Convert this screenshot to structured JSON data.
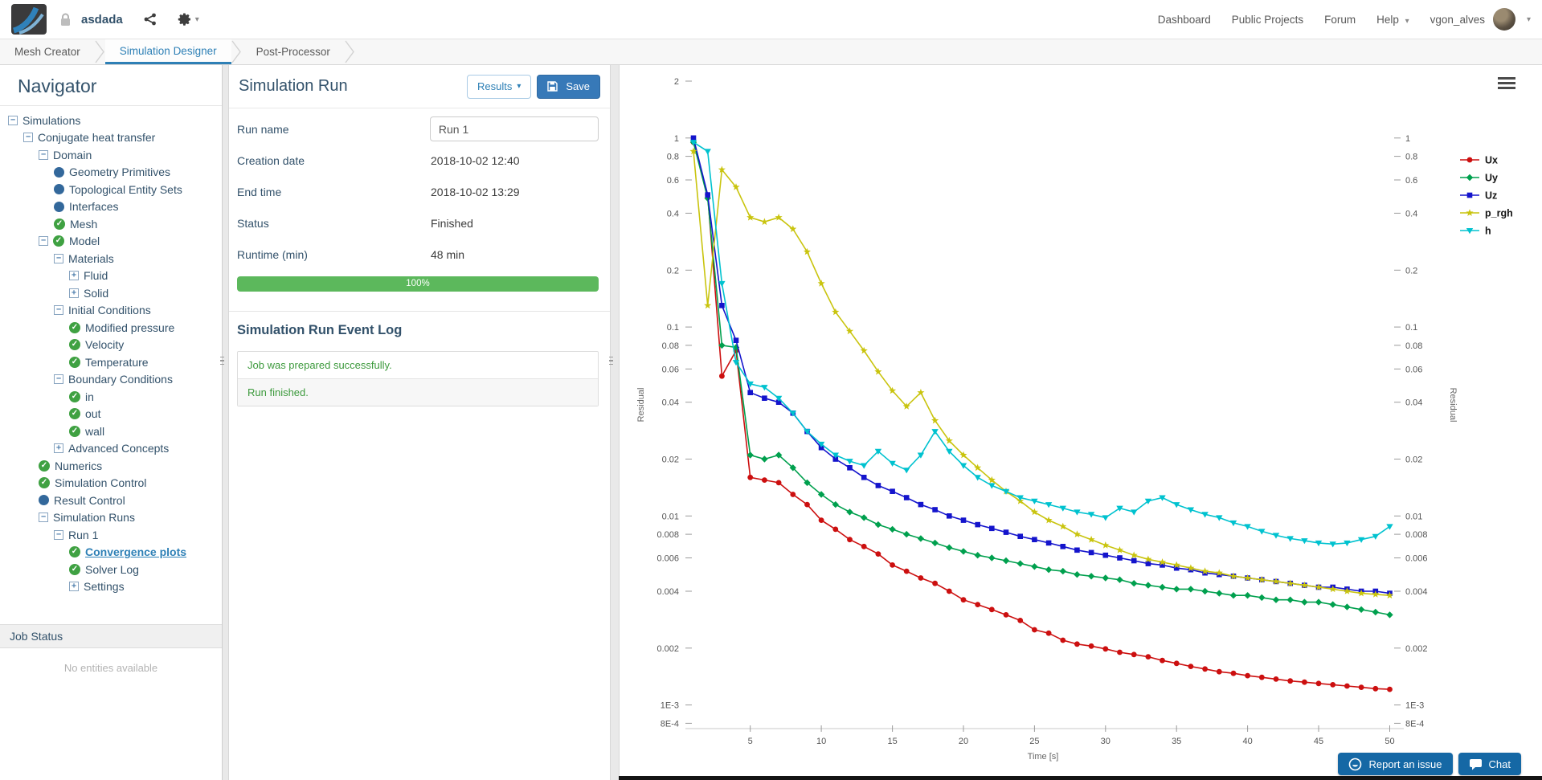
{
  "navbar": {
    "project_name": "asdada",
    "links": [
      "Dashboard",
      "Public Projects",
      "Forum"
    ],
    "help_label": "Help",
    "username": "vgon_alves"
  },
  "tabs": [
    {
      "label": "Mesh Creator",
      "active": false
    },
    {
      "label": "Simulation Designer",
      "active": true
    },
    {
      "label": "Post-Processor",
      "active": false
    }
  ],
  "navigator": {
    "title": "Navigator",
    "tree": [
      {
        "label": "Simulations",
        "level": 0,
        "box": "minus",
        "mark": null
      },
      {
        "label": "Conjugate heat transfer",
        "level": 1,
        "box": "minus",
        "mark": null
      },
      {
        "label": "Domain",
        "level": 2,
        "box": "minus",
        "mark": null
      },
      {
        "label": "Geometry Primitives",
        "level": 3,
        "box": null,
        "mark": "dot"
      },
      {
        "label": "Topological Entity Sets",
        "level": 3,
        "box": null,
        "mark": "dot"
      },
      {
        "label": "Interfaces",
        "level": 3,
        "box": null,
        "mark": "dot"
      },
      {
        "label": "Mesh",
        "level": 3,
        "box": null,
        "mark": "check"
      },
      {
        "label": "Model",
        "level": 2,
        "box": "minus",
        "mark": "check"
      },
      {
        "label": "Materials",
        "level": 3,
        "box": "minus",
        "mark": null
      },
      {
        "label": "Fluid",
        "level": 4,
        "box": "plus",
        "mark": null
      },
      {
        "label": "Solid",
        "level": 4,
        "box": "plus",
        "mark": null
      },
      {
        "label": "Initial Conditions",
        "level": 3,
        "box": "minus",
        "mark": null
      },
      {
        "label": "Modified pressure",
        "level": 4,
        "box": null,
        "mark": "check"
      },
      {
        "label": "Velocity",
        "level": 4,
        "box": null,
        "mark": "check"
      },
      {
        "label": "Temperature",
        "level": 4,
        "box": null,
        "mark": "check"
      },
      {
        "label": "Boundary Conditions",
        "level": 3,
        "box": "minus",
        "mark": null
      },
      {
        "label": "in",
        "level": 4,
        "box": null,
        "mark": "check"
      },
      {
        "label": "out",
        "level": 4,
        "box": null,
        "mark": "check"
      },
      {
        "label": "wall",
        "level": 4,
        "box": null,
        "mark": "check"
      },
      {
        "label": "Advanced Concepts",
        "level": 3,
        "box": "plus",
        "mark": null
      },
      {
        "label": "Numerics",
        "level": 2,
        "box": null,
        "mark": "check"
      },
      {
        "label": "Simulation Control",
        "level": 2,
        "box": null,
        "mark": "check"
      },
      {
        "label": "Result Control",
        "level": 2,
        "box": null,
        "mark": "dot"
      },
      {
        "label": "Simulation Runs",
        "level": 2,
        "box": "minus",
        "mark": null
      },
      {
        "label": "Run 1",
        "level": 3,
        "box": "minus",
        "mark": null
      },
      {
        "label": "Convergence plots",
        "level": 4,
        "box": null,
        "mark": "check",
        "selected": true
      },
      {
        "label": "Solver Log",
        "level": 4,
        "box": null,
        "mark": "check"
      },
      {
        "label": "Settings",
        "level": 4,
        "box": "plus",
        "mark": null
      }
    ],
    "job_status": {
      "title": "Job Status",
      "empty_text": "No entities available"
    }
  },
  "run_panel": {
    "title": "Simulation Run",
    "results_button": "Results",
    "save_button": "Save",
    "fields": [
      {
        "label": "Run name",
        "value": "Run 1",
        "type": "input"
      },
      {
        "label": "Creation date",
        "value": "2018-10-02 12:40"
      },
      {
        "label": "End time",
        "value": "2018-10-02 13:29"
      },
      {
        "label": "Status",
        "value": "Finished"
      },
      {
        "label": "Runtime (min)",
        "value": "48 min"
      }
    ],
    "progress": {
      "label": "100%",
      "percent": 100,
      "color": "#5cb85c"
    },
    "event_log": {
      "title": "Simulation Run Event Log",
      "events": [
        "Job was prepared successfully.",
        "Run finished."
      ]
    }
  },
  "footer_buttons": [
    {
      "label": "Report an issue",
      "icon": "smiley-icon"
    },
    {
      "label": "Chat",
      "icon": "chat-icon"
    }
  ],
  "chart_data": {
    "type": "line",
    "xlabel": "Time [s]",
    "ylabel_left": "Residual",
    "ylabel_right": "Residual",
    "y_scale": "log",
    "grid": false,
    "legend_position": "right",
    "xlim": [
      1,
      50.2
    ],
    "ylim": [
      0.00075,
      2.0
    ],
    "x_ticks": [
      5,
      10,
      15,
      20,
      25,
      30,
      35,
      40,
      45,
      50
    ],
    "y_ticks_left": [
      {
        "v": 2,
        "label": "2"
      },
      {
        "v": 1,
        "label": "1"
      },
      {
        "v": 0.8,
        "label": "0.8"
      },
      {
        "v": 0.6,
        "label": "0.6"
      },
      {
        "v": 0.4,
        "label": "0.4"
      },
      {
        "v": 0.2,
        "label": "0.2"
      },
      {
        "v": 0.1,
        "label": "0.1"
      },
      {
        "v": 0.08,
        "label": "0.08"
      },
      {
        "v": 0.06,
        "label": "0.06"
      },
      {
        "v": 0.04,
        "label": "0.04"
      },
      {
        "v": 0.02,
        "label": "0.02"
      },
      {
        "v": 0.01,
        "label": "0.01"
      },
      {
        "v": 0.008,
        "label": "0.008"
      },
      {
        "v": 0.006,
        "label": "0.006"
      },
      {
        "v": 0.004,
        "label": "0.004"
      },
      {
        "v": 0.002,
        "label": "0.002"
      },
      {
        "v": 0.001,
        "label": "1E-3"
      },
      {
        "v": 0.0008,
        "label": "8E-4"
      }
    ],
    "y_ticks_right": [
      {
        "v": 1,
        "label": "1"
      },
      {
        "v": 0.8,
        "label": "0.8"
      },
      {
        "v": 0.6,
        "label": "0.6"
      },
      {
        "v": 0.4,
        "label": "0.4"
      },
      {
        "v": 0.2,
        "label": "0.2"
      },
      {
        "v": 0.1,
        "label": "0.1"
      },
      {
        "v": 0.08,
        "label": "0.08"
      },
      {
        "v": 0.06,
        "label": "0.06"
      },
      {
        "v": 0.04,
        "label": "0.04"
      },
      {
        "v": 0.02,
        "label": "0.02"
      },
      {
        "v": 0.01,
        "label": "0.01"
      },
      {
        "v": 0.008,
        "label": "0.008"
      },
      {
        "v": 0.006,
        "label": "0.006"
      },
      {
        "v": 0.004,
        "label": "0.004"
      },
      {
        "v": 0.002,
        "label": "0.002"
      },
      {
        "v": 0.001,
        "label": "1E-3"
      },
      {
        "v": 0.0008,
        "label": "8E-4"
      }
    ],
    "x": [
      1,
      2,
      3,
      4,
      5,
      6,
      7,
      8,
      9,
      10,
      11,
      12,
      13,
      14,
      15,
      16,
      17,
      18,
      19,
      20,
      21,
      22,
      23,
      24,
      25,
      26,
      27,
      28,
      29,
      30,
      31,
      32,
      33,
      34,
      35,
      36,
      37,
      38,
      39,
      40,
      41,
      42,
      43,
      44,
      45,
      46,
      47,
      48,
      49,
      50
    ],
    "series": [
      {
        "name": "Ux",
        "color": "#cc0f0f",
        "marker": "circle",
        "y": [
          0.95,
          0.5,
          0.055,
          0.075,
          0.016,
          0.0155,
          0.015,
          0.013,
          0.0115,
          0.0095,
          0.0085,
          0.0075,
          0.0069,
          0.0063,
          0.0055,
          0.0051,
          0.0047,
          0.0044,
          0.004,
          0.0036,
          0.0034,
          0.0032,
          0.003,
          0.0028,
          0.0025,
          0.0024,
          0.0022,
          0.0021,
          0.00205,
          0.00198,
          0.0019,
          0.00185,
          0.0018,
          0.00172,
          0.00166,
          0.0016,
          0.00155,
          0.0015,
          0.00147,
          0.00143,
          0.0014,
          0.00137,
          0.00134,
          0.00132,
          0.0013,
          0.00128,
          0.00126,
          0.00124,
          0.00122,
          0.00121
        ]
      },
      {
        "name": "Uy",
        "color": "#00a04e",
        "marker": "diamond",
        "y": [
          0.95,
          0.48,
          0.08,
          0.078,
          0.021,
          0.02,
          0.021,
          0.018,
          0.015,
          0.013,
          0.0115,
          0.0105,
          0.0098,
          0.009,
          0.0085,
          0.008,
          0.0076,
          0.0072,
          0.0068,
          0.0065,
          0.0062,
          0.006,
          0.0058,
          0.0056,
          0.0054,
          0.0052,
          0.0051,
          0.0049,
          0.0048,
          0.0047,
          0.0046,
          0.0044,
          0.0043,
          0.0042,
          0.0041,
          0.0041,
          0.004,
          0.0039,
          0.0038,
          0.0038,
          0.0037,
          0.0036,
          0.0036,
          0.0035,
          0.0035,
          0.0034,
          0.0033,
          0.0032,
          0.0031,
          0.003
        ]
      },
      {
        "name": "Uz",
        "color": "#1414cc",
        "marker": "square",
        "y": [
          1.0,
          0.5,
          0.13,
          0.085,
          0.045,
          0.042,
          0.04,
          0.035,
          0.028,
          0.023,
          0.02,
          0.018,
          0.016,
          0.0145,
          0.0135,
          0.0125,
          0.0115,
          0.0108,
          0.01,
          0.0095,
          0.009,
          0.0086,
          0.0082,
          0.0078,
          0.0075,
          0.0072,
          0.0069,
          0.0066,
          0.0064,
          0.0062,
          0.006,
          0.0058,
          0.0056,
          0.0055,
          0.0053,
          0.0052,
          0.005,
          0.0049,
          0.0048,
          0.0047,
          0.0046,
          0.0045,
          0.0044,
          0.0043,
          0.0042,
          0.0042,
          0.0041,
          0.004,
          0.004,
          0.0039
        ]
      },
      {
        "name": "p_rgh",
        "color": "#c9c40e",
        "marker": "star",
        "y": [
          0.85,
          0.13,
          0.68,
          0.55,
          0.38,
          0.36,
          0.38,
          0.33,
          0.25,
          0.17,
          0.12,
          0.095,
          0.075,
          0.058,
          0.046,
          0.038,
          0.045,
          0.032,
          0.025,
          0.021,
          0.018,
          0.0155,
          0.0135,
          0.012,
          0.0105,
          0.0095,
          0.0088,
          0.008,
          0.0075,
          0.007,
          0.0066,
          0.0062,
          0.0059,
          0.0057,
          0.0055,
          0.0053,
          0.0051,
          0.005,
          0.0048,
          0.0047,
          0.0046,
          0.0045,
          0.0044,
          0.0043,
          0.0042,
          0.0041,
          0.004,
          0.0039,
          0.00385,
          0.0038
        ]
      },
      {
        "name": "h",
        "color": "#00c2cf",
        "marker": "triangle-down",
        "y": [
          0.95,
          0.85,
          0.17,
          0.065,
          0.05,
          0.048,
          0.042,
          0.035,
          0.028,
          0.024,
          0.021,
          0.0195,
          0.0185,
          0.022,
          0.019,
          0.0175,
          0.021,
          0.028,
          0.022,
          0.0185,
          0.016,
          0.0145,
          0.0135,
          0.0125,
          0.012,
          0.0115,
          0.011,
          0.0105,
          0.0102,
          0.0098,
          0.011,
          0.0105,
          0.012,
          0.0125,
          0.0115,
          0.0108,
          0.0102,
          0.0098,
          0.0092,
          0.0088,
          0.0083,
          0.0079,
          0.0076,
          0.0074,
          0.0072,
          0.0071,
          0.0072,
          0.0075,
          0.0078,
          0.0088
        ]
      }
    ]
  }
}
